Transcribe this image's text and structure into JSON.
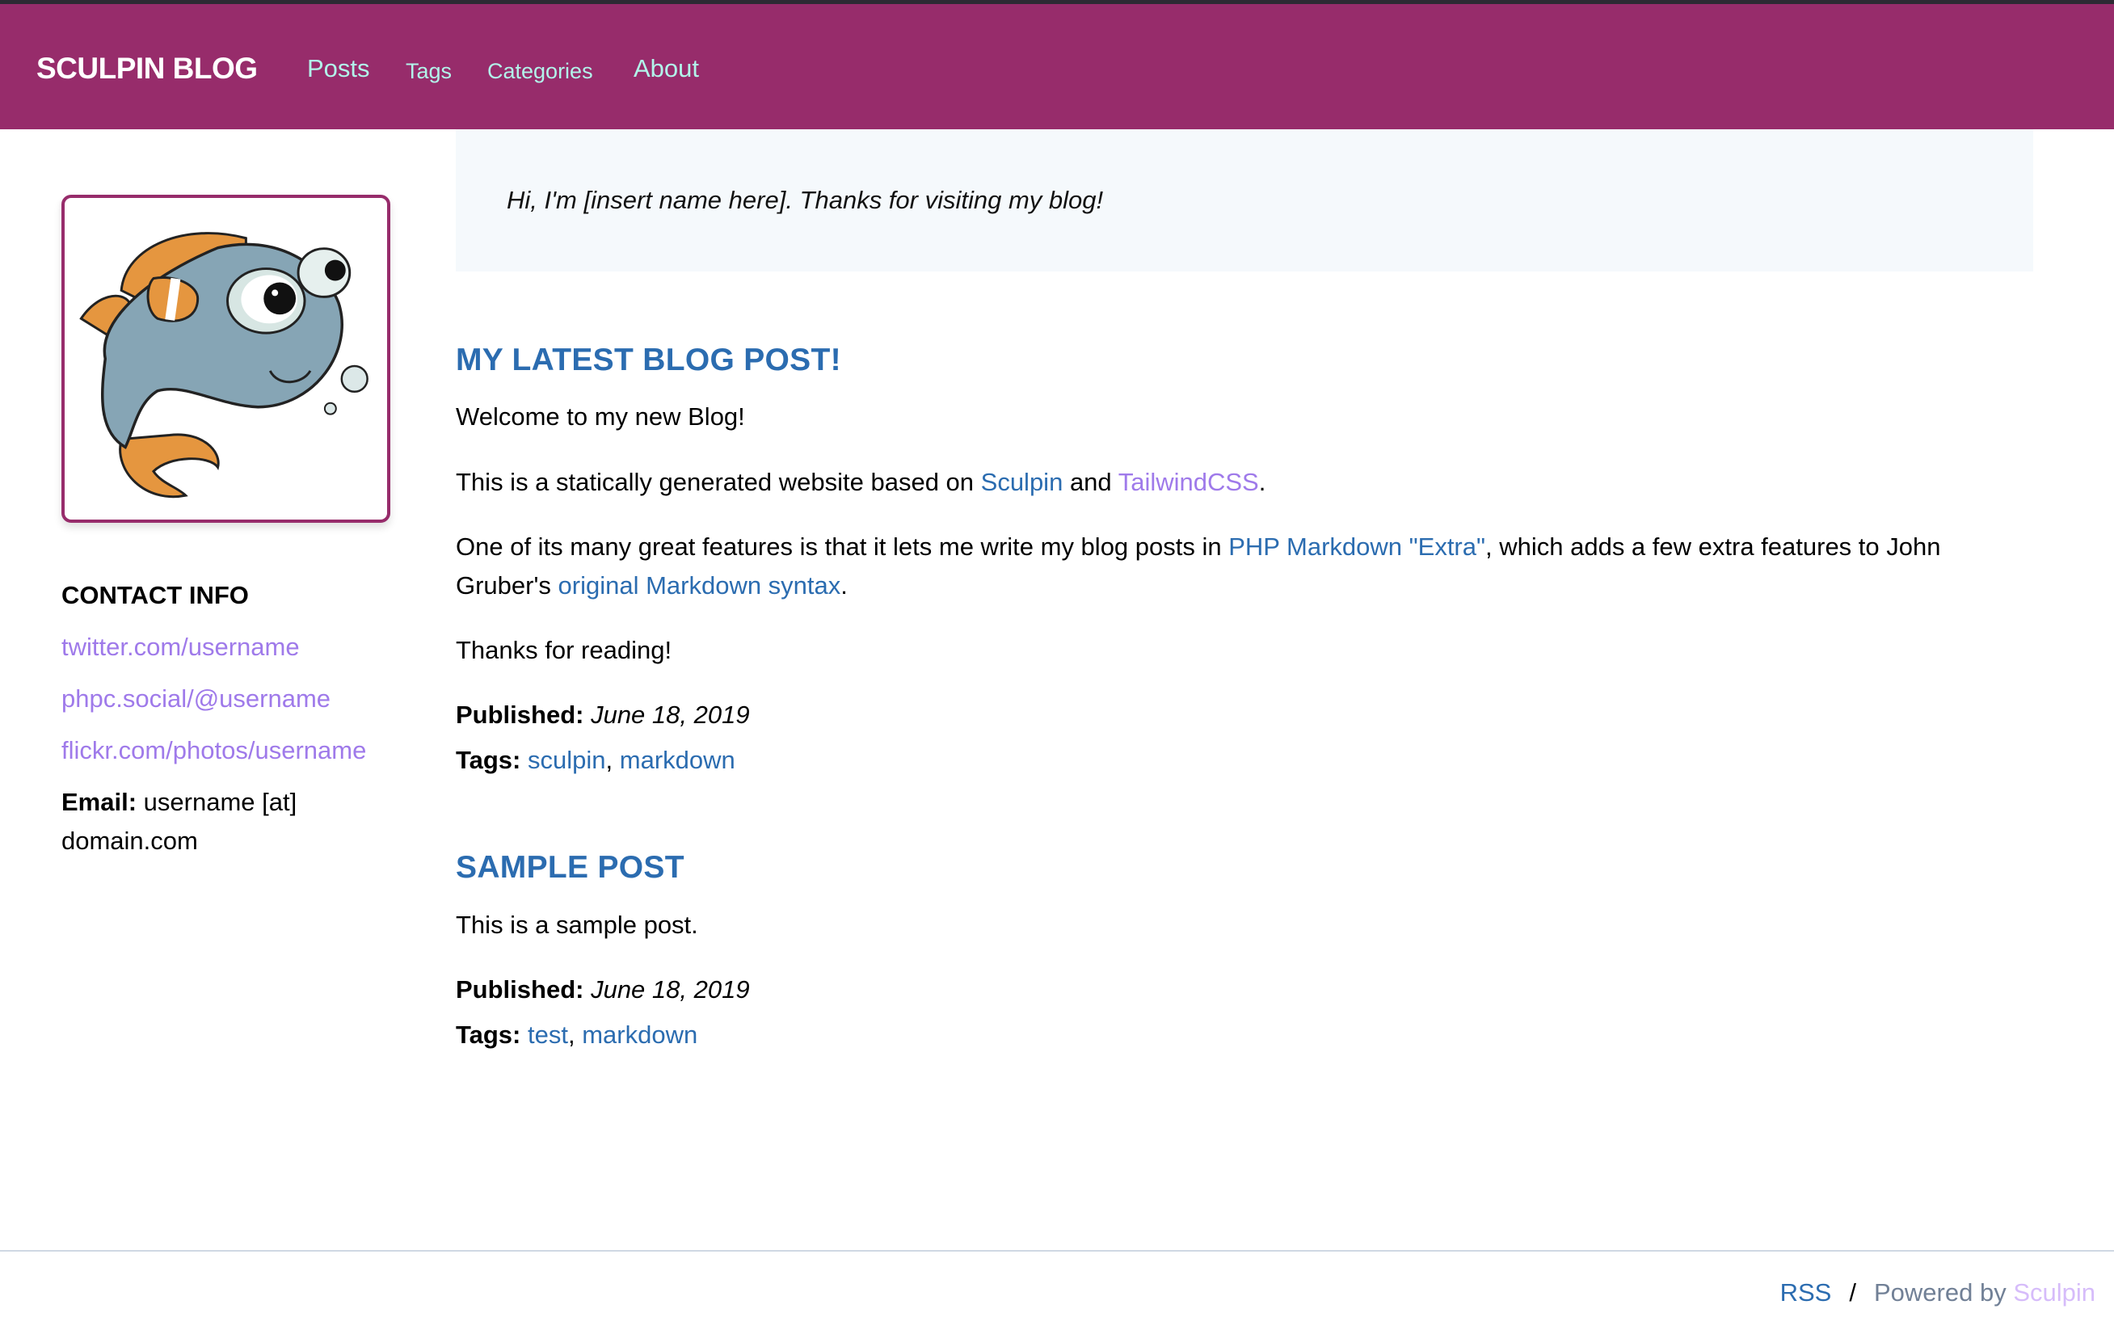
{
  "header": {
    "logo": "SCULPIN BLOG",
    "nav": [
      {
        "label": "Posts"
      },
      {
        "label": "Tags"
      },
      {
        "label": "Categories"
      },
      {
        "label": "About"
      }
    ],
    "colors": {
      "bar": "#972c6b",
      "nav_link": "#b2f5ea"
    }
  },
  "sidebar": {
    "avatar_icon": "sculpin-fish-mascot",
    "contact_title": "CONTACT INFO",
    "links": [
      {
        "label": "twitter.com/username"
      },
      {
        "label": "phpc.social/@username"
      },
      {
        "label": "flickr.com/photos/username"
      }
    ],
    "email_label": "Email:",
    "email_value": "username [at] domain.com"
  },
  "intro": {
    "text": "Hi, I'm [insert name here]. Thanks for visiting my blog!"
  },
  "posts": [
    {
      "title": "MY LATEST BLOG POST!",
      "paragraphs": {
        "welcome": "Welcome to my new Blog!",
        "p2_before": "This is a statically generated website based on ",
        "p2_link1": "Sculpin",
        "p2_mid": " and ",
        "p2_link2": "TailwindCSS",
        "p2_after": ".",
        "p3_before": "One of its many great features is that it lets me write my blog posts in ",
        "p3_link1": "PHP Markdown \"Extra\"",
        "p3_mid": ", which adds a few extra features to John Gruber's ",
        "p3_link2": "original Markdown syntax",
        "p3_after": ".",
        "thanks": "Thanks for reading!"
      },
      "published_label": "Published:",
      "published_date": "June 18, 2019",
      "tags_label": "Tags:",
      "tags": [
        "sculpin",
        "markdown"
      ]
    },
    {
      "title": "SAMPLE POST",
      "paragraphs": {
        "body": "This is a sample post."
      },
      "published_label": "Published:",
      "published_date": "June 18, 2019",
      "tags_label": "Tags:",
      "tags": [
        "test",
        "markdown"
      ]
    }
  ],
  "footer": {
    "rss": "RSS",
    "separator": "/",
    "powered_by": "Powered by ",
    "sculpin": "Sculpin"
  }
}
